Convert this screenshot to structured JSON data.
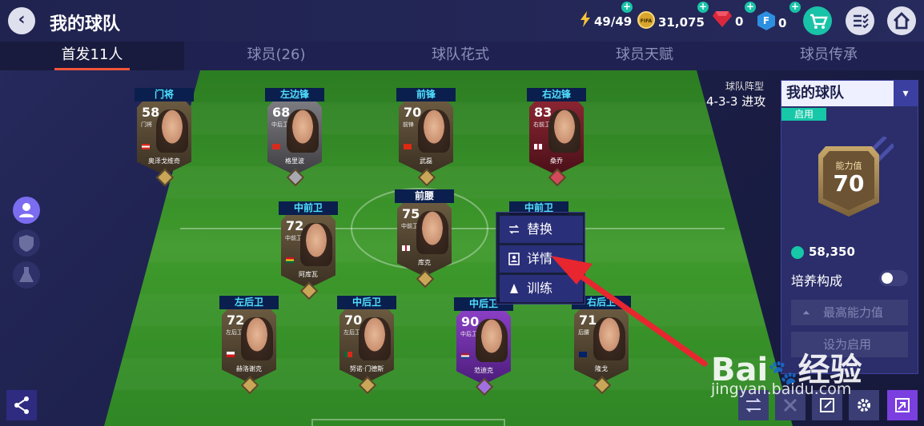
{
  "header": {
    "title": "我的球队",
    "energy": "49/49",
    "coins": "31,075",
    "gems": "0",
    "fpoints": "0"
  },
  "tabs": [
    {
      "label": "首发11人"
    },
    {
      "label": "球员(26)"
    },
    {
      "label": "球队花式"
    },
    {
      "label": "球员天赋"
    },
    {
      "label": "球员传承"
    }
  ],
  "players": [
    {
      "pos": "门将",
      "ovr": "58",
      "cpos": "门将",
      "name": "奥泽戈维奇"
    },
    {
      "pos": "左边锋",
      "ovr": "68",
      "cpos": "中后卫",
      "name": "格里波"
    },
    {
      "pos": "前锋",
      "ovr": "70",
      "cpos": "前锋",
      "name": "武磊"
    },
    {
      "pos": "右边锋",
      "ovr": "83",
      "cpos": "右前卫",
      "name": "桑乔"
    },
    {
      "pos": "中前卫",
      "ovr": "72",
      "cpos": "中前卫",
      "name": "阿库瓦"
    },
    {
      "pos": "前腰",
      "ovr": "75",
      "cpos": "中前卫",
      "name": "库克"
    },
    {
      "pos": "中前卫",
      "ovr": "",
      "cpos": "",
      "name": ""
    },
    {
      "pos": "左后卫",
      "ovr": "72",
      "cpos": "左后卫",
      "name": "赫洛谢克"
    },
    {
      "pos": "中后卫",
      "ovr": "70",
      "cpos": "左后卫",
      "name": "努诺·门德斯"
    },
    {
      "pos": "中后卫",
      "ovr": "90",
      "cpos": "中后卫",
      "name": "范迪克"
    },
    {
      "pos": "右后卫",
      "ovr": "71",
      "cpos": "后腰",
      "name": "隆戈"
    }
  ],
  "menu": {
    "replace": "替换",
    "details": "详情",
    "train": "训练"
  },
  "formation": {
    "label": "球队阵型",
    "value": "4-3-3 进攻"
  },
  "panel": {
    "team_name": "我的球队",
    "active_badge": "启用",
    "ability_label": "能力值",
    "ability_value": "70",
    "coins": "58,350",
    "train_label": "培养构成",
    "max_btn": "最高能力值",
    "set_btn": "设为启用"
  },
  "watermark": {
    "logo": "Bai经验",
    "url": "jingyan.baidu.com"
  },
  "colors": {
    "accent": "#f0553a",
    "teal": "#16c7a8",
    "arrow": "#e8262f"
  }
}
